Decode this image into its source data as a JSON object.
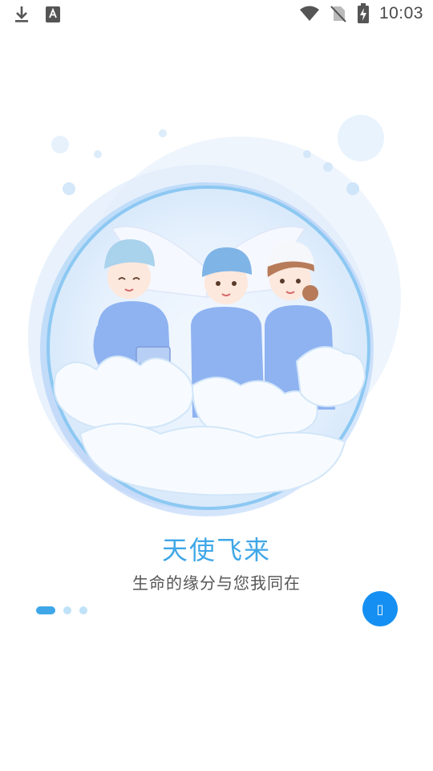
{
  "status_bar": {
    "time": "10:03",
    "left_icons": [
      "download-icon",
      "keyboard-a-icon"
    ],
    "right_icons": [
      "wifi-icon",
      "no-sim-icon",
      "battery-charging-icon"
    ]
  },
  "onboarding": {
    "title": "天使飞来",
    "subtitle": "生命的缘分与您我同在",
    "page_count": 3,
    "current_page": 1,
    "next_button_glyph": "▯"
  },
  "colors": {
    "accent": "#3fa7e8",
    "button": "#1590f2",
    "dot_inactive": "#bfe2f8",
    "subtitle": "#555555",
    "scrub": "#a9c8f4"
  }
}
